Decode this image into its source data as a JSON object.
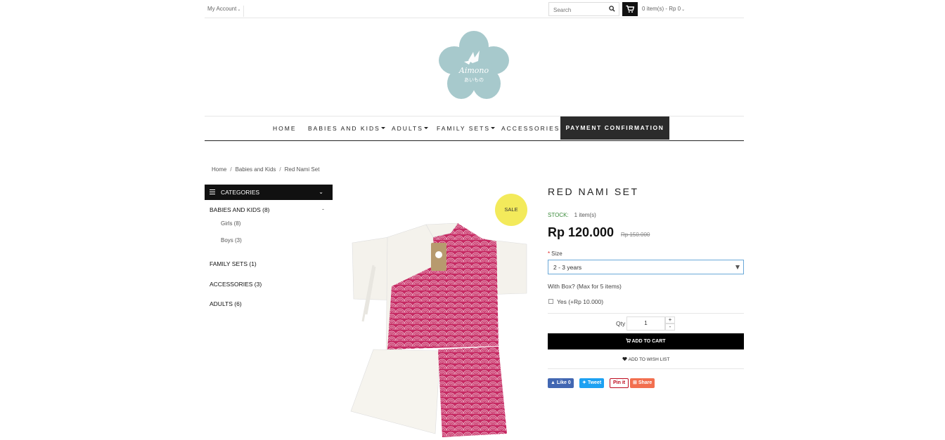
{
  "topbar": {
    "account_label": "My Account",
    "search_placeholder": "Search",
    "cart_summary": "0 item(s) - Rp 0"
  },
  "logo": {
    "brand": "Aimono",
    "brand_jp": "あいもの"
  },
  "nav": {
    "items": [
      {
        "label": "HOME",
        "dropdown": false
      },
      {
        "label": "BABIES AND KIDS",
        "dropdown": true
      },
      {
        "label": "ADULTS",
        "dropdown": true
      },
      {
        "label": "FAMILY SETS",
        "dropdown": true
      },
      {
        "label": "ACCESSORIES",
        "dropdown": false
      }
    ],
    "highlight": "PAYMENT CONFIRMATION"
  },
  "breadcrumb": [
    "Home",
    "Babies and Kids",
    "Red Nami Set"
  ],
  "sidebar": {
    "heading": "CATEGORIES",
    "items": [
      {
        "label": "BABIES AND KIDS (8)",
        "toggle": "-",
        "children": [
          "Girls (8)",
          "Boys (3)"
        ]
      },
      {
        "label": "FAMILY SETS (1)"
      },
      {
        "label": "ACCESSORIES (3)"
      },
      {
        "label": "ADULTS (6)"
      }
    ]
  },
  "product": {
    "sale_badge": "SALE",
    "title": "RED NAMI SET",
    "stock_label": "STOCK:",
    "stock_value": "1 item(s)",
    "price": "Rp 120.000",
    "old_price": "Rp 150.000",
    "size_label": "Size",
    "size_value": "2 - 3 years",
    "box_label": "With Box? (Max for 5 items)",
    "box_option": "Yes (+Rp 10.000)",
    "qty_label": "Qty",
    "qty_value": "1",
    "add_to_cart": "ADD TO CART",
    "wishlist": "ADD TO WISH LIST"
  },
  "share": {
    "facebook": "Like 0",
    "twitter": "Tweet",
    "pinterest": "Pin it",
    "share": "Share"
  },
  "colors": {
    "logo": "#a7c9cc",
    "fabric_pink": "#c62a63",
    "sale_yellow": "#f3ea5b",
    "stock_green": "#3a8a3a"
  }
}
